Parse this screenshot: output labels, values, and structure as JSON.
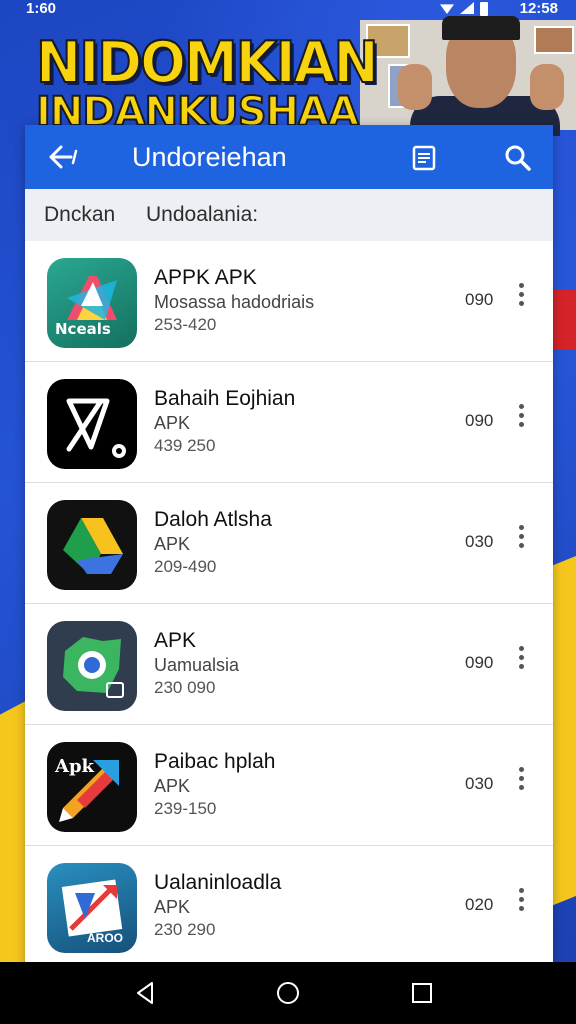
{
  "status_bar": {
    "time_left": "1:60",
    "time_right": "12:58"
  },
  "banner": {
    "title_line1": "NIDOMKIAN",
    "title_line2": "INDANKUSHAA"
  },
  "app_bar": {
    "title": "Undoreiehan",
    "back_icon": "arrow-back-icon",
    "doc_icon": "document-icon",
    "search_icon": "search-icon"
  },
  "sub_header": {
    "left": "Dnckan",
    "right": "Undoalania:"
  },
  "apps": [
    {
      "name": "APPK APK",
      "subtitle": "Mosassa hadodriais",
      "meta": "253-420",
      "count": "090",
      "icon": "nceals-app-icon",
      "icon_label": "Nceals",
      "icon_bg": "#1e8c7a"
    },
    {
      "name": "Bahaih Eojhian",
      "subtitle": "APK",
      "meta": "439 250",
      "count": "090",
      "icon": "xa-app-icon",
      "icon_label": "",
      "icon_bg": "#000000"
    },
    {
      "name": "Daloh Atlsha",
      "subtitle": "APK",
      "meta": "209-490",
      "count": "030",
      "icon": "drive-app-icon",
      "icon_label": "",
      "icon_bg": "#111111"
    },
    {
      "name": "APK",
      "subtitle": "Uamualsia",
      "meta": "230 090",
      "count": "090",
      "icon": "map-pin-app-icon",
      "icon_label": "",
      "icon_bg": "#2f3d4e"
    },
    {
      "name": "Paibac hplah",
      "subtitle": "APK",
      "meta": "239-150",
      "count": "030",
      "icon": "apk-pencil-app-icon",
      "icon_label": "Apk",
      "icon_bg": "#0d0d0d"
    },
    {
      "name": "Ualaninloadla",
      "subtitle": "APK",
      "meta": "230 290",
      "count": "020",
      "icon": "map-arrow-app-icon",
      "icon_label": "AROO",
      "icon_bg": "#1f6e9a"
    }
  ],
  "nav_bar": {
    "back": "nav-back-icon",
    "home": "nav-home-icon",
    "recents": "nav-recents-icon"
  },
  "colors": {
    "app_bar": "#1e63e0",
    "banner_yellow": "#f8d410",
    "background_blue": "#1f4fc4"
  }
}
